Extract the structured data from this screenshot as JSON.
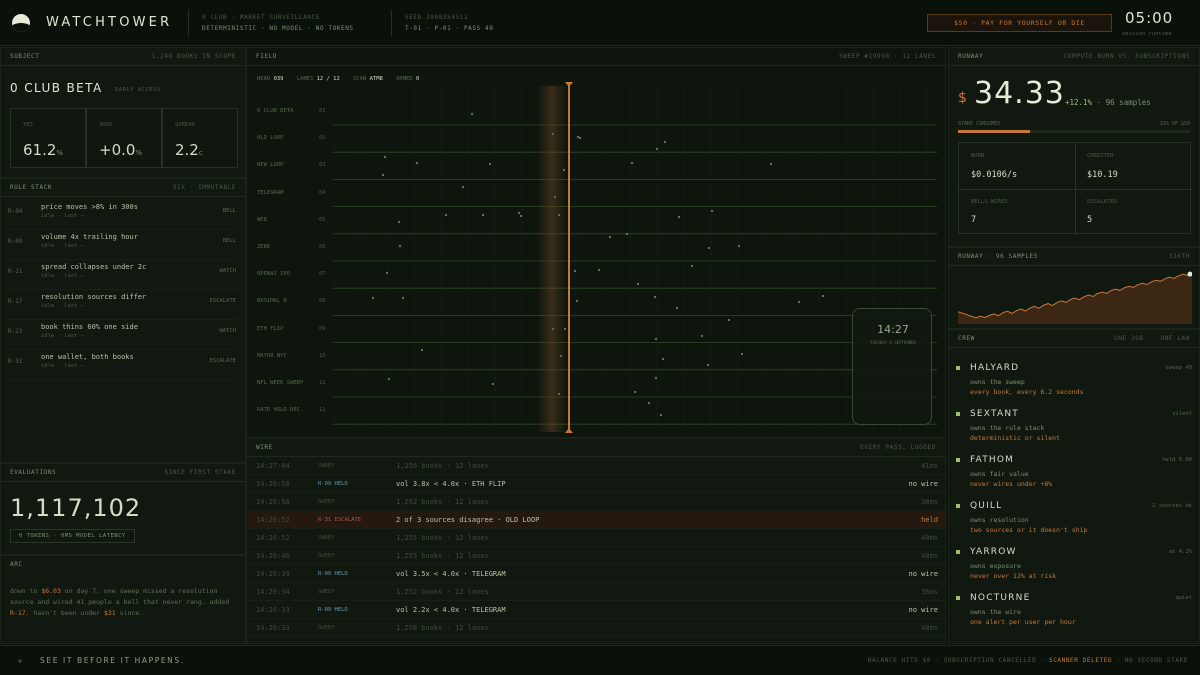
{
  "brand": {
    "name": "WATCHTOWER"
  },
  "header": {
    "club_line": "0 CLUB · MARKET SURVEILLANCE",
    "flags": "DETERMINISTIC · NO MODEL · NO TOKENS",
    "seed": "SEED 3908354511",
    "pass": "T-01 · P-01 · PASS 49",
    "cta": "$50 · PAY FOR YOURSELF OR DIE",
    "timer": "05:00",
    "timer_label": "session runtime"
  },
  "subject": {
    "header": "SUBJECT",
    "header_right": "1,248 BOOKS IN SCOPE",
    "name": "0 CLUB BETA",
    "tag": "EARLY ACCESS",
    "stats": [
      {
        "label": "YES",
        "value": "61.2",
        "unit": "%"
      },
      {
        "label": "300S",
        "value": "+0.0",
        "unit": "%"
      },
      {
        "label": "SPREAD",
        "value": "2.2",
        "unit": "c"
      }
    ]
  },
  "rule_stack": {
    "header": "RULE STACK",
    "header_right": "SIX · IMMUTABLE",
    "rules": [
      {
        "id": "R-04",
        "text": "price moves >8% in 300s",
        "sub": "idle · last –",
        "action": "BELL"
      },
      {
        "id": "R-09",
        "text": "volume 4x trailing hour",
        "sub": "idle · last –",
        "action": "BELL"
      },
      {
        "id": "R-11",
        "text": "spread collapses under 2c",
        "sub": "idle · last –",
        "action": "WATCH"
      },
      {
        "id": "R-17",
        "text": "resolution sources differ",
        "sub": "idle · last –",
        "action": "ESCALATE"
      },
      {
        "id": "R-23",
        "text": "book thins 60% one side",
        "sub": "idle · last –",
        "action": "WATCH"
      },
      {
        "id": "R-31",
        "text": "one wallet, both books",
        "sub": "idle · last –",
        "action": "ESCALATE"
      }
    ]
  },
  "evaluations": {
    "header": "EVALUATIONS",
    "header_right": "SINCE FIRST STAKE",
    "value": "1,117,102",
    "badge": "0 TOKENS · 0MS MODEL LATENCY"
  },
  "arc": {
    "header": "ARC",
    "text_a": "down to ",
    "text_amount": "$6.03",
    "text_b": " on day 7. one sweep missed a resolution source and wired 41 people a bell that never rang. added ",
    "text_rule": "R-17",
    "text_c": ". hasn't been under ",
    "text_amount2": "$31",
    "text_d": " since."
  },
  "field": {
    "header": "FIELD",
    "header_right": "SWEEP #19998 · 12 LANES",
    "status": {
      "head_label": "HEAD",
      "head_value": "039",
      "lanes_label": "LANES",
      "lanes_value": "12 / 12",
      "scan_label": "SCAN",
      "scan_value": "ATM8",
      "armed_label": "ARMED",
      "armed_value": "0"
    },
    "lanes": [
      {
        "label": "0 CLUB BETA",
        "num": "01"
      },
      {
        "label": "OLD LOOP",
        "num": "02"
      },
      {
        "label": "NEW LOOP",
        "num": "03"
      },
      {
        "label": "TELEGRAM",
        "num": "04"
      },
      {
        "label": "WEB",
        "num": "05"
      },
      {
        "label": "ZERK",
        "num": "06"
      },
      {
        "label": "OPENAI IPO",
        "num": "07"
      },
      {
        "label": "BASIMAL B",
        "num": "08"
      },
      {
        "label": "ETH FLIP",
        "num": "09"
      },
      {
        "label": "MAYOR NYC",
        "num": "10"
      },
      {
        "label": "NFL WEEK SWEEP",
        "num": "11"
      },
      {
        "label": "RATE HOLD DEC",
        "num": "12"
      }
    ],
    "clock": {
      "time": "14:27",
      "date": "TUESDAY 8 SEPTEMBER"
    }
  },
  "wire": {
    "header": "WIRE",
    "header_right": "EVERY PASS, LOGGED",
    "rows": [
      {
        "time": "14:27:04",
        "kind": "SWEEP",
        "msg": "1,256 books · 12 lanes",
        "result": "41ms",
        "tone": "dim"
      },
      {
        "time": "14:26:58",
        "kind": "R-09 HELD",
        "msg": "vol 3.8x < 4.0x · ETH FLIP",
        "result": "no wire",
        "tone": "held"
      },
      {
        "time": "14:26:58",
        "kind": "SWEEP",
        "msg": "1,262 books · 12 lanes",
        "result": "38ms",
        "tone": "dim"
      },
      {
        "time": "14:26:52",
        "kind": "R-31 ESCALATE",
        "msg": "2 of 3 sources disagree · OLD LOOP",
        "result": "held",
        "tone": "esc"
      },
      {
        "time": "14:26:52",
        "kind": "SWEEP",
        "msg": "1,255 books · 12 lanes",
        "result": "40ms",
        "tone": "dim"
      },
      {
        "time": "14:26:46",
        "kind": "SWEEP",
        "msg": "1,255 books · 12 lanes",
        "result": "40ms",
        "tone": "dim"
      },
      {
        "time": "14:26:39",
        "kind": "R-09 HELD",
        "msg": "vol 3.5x < 4.0x · TELEGRAM",
        "result": "no wire",
        "tone": "held"
      },
      {
        "time": "14:26:34",
        "kind": "SWEEP",
        "msg": "1,252 books · 12 lanes",
        "result": "36ms",
        "tone": "dim"
      },
      {
        "time": "14:26:33",
        "kind": "R-09 HELD",
        "msg": "vol 2.2x < 4.0x · TELEGRAM",
        "result": "no wire",
        "tone": "held"
      },
      {
        "time": "14:26:33",
        "kind": "SWEEP",
        "msg": "1,258 books · 12 lanes",
        "result": "40ms",
        "tone": "dim"
      }
    ]
  },
  "runway": {
    "header": "RUNWAY",
    "header_right": "COMPUTE BURN VS. SUBSCRIPTIONS",
    "currency": "$",
    "balance": "34.33",
    "change": "+12.1%",
    "samples": "· 96 samples",
    "stake_label": "STAKE CONSUMED",
    "stake_value": "31% OF $50",
    "stake_fraction": 0.31,
    "cells": [
      {
        "label": "BURN",
        "value": "$0.0106/s"
      },
      {
        "label": "CREDITED",
        "value": "$10.19"
      },
      {
        "label": "BELLS WIRED",
        "value": "7"
      },
      {
        "label": "ESCALATED",
        "value": "5"
      }
    ]
  },
  "runway_chart": {
    "header": "RUNWAY · 96 SAMPLES",
    "header_right": "316TH"
  },
  "chart_data": {
    "type": "area",
    "title": "RUNWAY · 96 SAMPLES",
    "series": [
      {
        "values": [
          19.0,
          18.4,
          17.8,
          17.1,
          16.5,
          17.2,
          16.6,
          17.5,
          18.1,
          17.4,
          18.6,
          19.2,
          18.3,
          19.4,
          20.1,
          19.3,
          20.5,
          21.2,
          20.4,
          21.6,
          22.3,
          21.5,
          22.7,
          23.4,
          22.8,
          24.0,
          24.6,
          23.9,
          25.1,
          25.8,
          25.2,
          26.4,
          27.0,
          26.5,
          27.6,
          28.2,
          27.7,
          28.8,
          29.3,
          28.9,
          30.0,
          30.6,
          30.1,
          31.2,
          31.8,
          31.4,
          32.4,
          33.1,
          32.6,
          33.6,
          34.3,
          33.8,
          34.33
        ]
      }
    ],
    "grid": false
  },
  "crew": {
    "header": "CREW",
    "header_mid": "ONE JOB",
    "header_right": "ONE LAW",
    "members": [
      {
        "name": "HALYARD",
        "status": "sweep 49",
        "desc": "owns the sweep",
        "law": "every book, every 6.2 seconds"
      },
      {
        "name": "SEXTANT",
        "status": "silent",
        "desc": "owns the rule stack",
        "law": "deterministic or silent"
      },
      {
        "name": "FATHOM",
        "status": "held 0.00",
        "desc": "owns fair value",
        "law": "never wires under +8%"
      },
      {
        "name": "QUILL",
        "status": "2 sources ok",
        "desc": "owns resolution",
        "law": "two sources or it doesn't ship"
      },
      {
        "name": "YARROW",
        "status": "at 4.1%",
        "desc": "owns exposure",
        "law": "never over 12% at risk"
      },
      {
        "name": "NOCTURNE",
        "status": "quiet",
        "desc": "owns the wire",
        "law": "one alert per user per hour"
      }
    ]
  },
  "footer": {
    "tagline": "SEE IT BEFORE IT HAPPENS.",
    "law_a": "BALANCE HITS $0",
    "law_b": "SUBSCRIPTION CANCELLED",
    "law_c": "SCANNER DELETED",
    "law_d": "NO SECOND STAKE"
  },
  "colors": {
    "accent": "#c8793a",
    "green": "#9fbf6e",
    "bg": "#0c120c"
  }
}
